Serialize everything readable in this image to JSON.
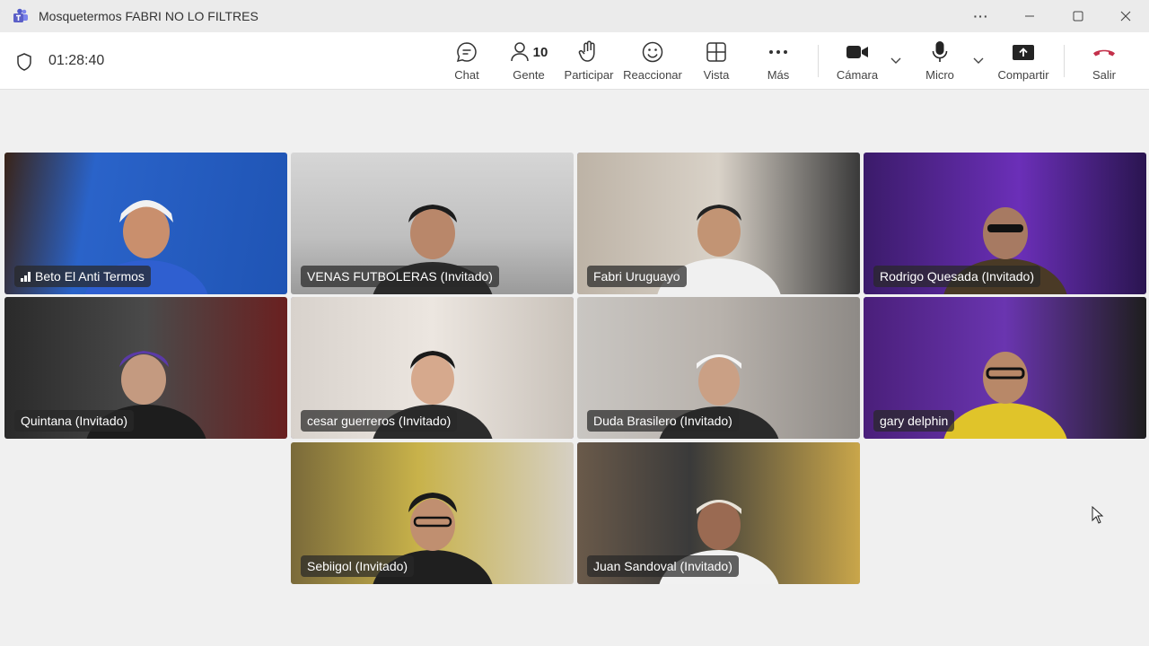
{
  "window": {
    "title": "Mosquetermos FABRI NO LO FILTRES"
  },
  "meeting": {
    "timer": "01:28:40"
  },
  "toolbar": {
    "chat": "Chat",
    "people_count": "10",
    "people": "Gente",
    "participate": "Participar",
    "react": "Reaccionar",
    "view": "Vista",
    "more": "Más",
    "camera": "Cámara",
    "mic": "Micro",
    "share": "Compartir",
    "leave": "Salir"
  },
  "participants": [
    {
      "name": "Beto El Anti Termos"
    },
    {
      "name": "VENAS FUTBOLERAS (Invitado)"
    },
    {
      "name": "Fabri Uruguayo"
    },
    {
      "name": "Rodrigo Quesada (Invitado)"
    },
    {
      "name": "Quintana (Invitado)"
    },
    {
      "name": "cesar guerreros (Invitado)"
    },
    {
      "name": "Duda Brasilero (Invitado)"
    },
    {
      "name": "gary delphin"
    },
    {
      "name": "Sebiigol (Invitado)"
    },
    {
      "name": "Juan Sandoval (Invitado)"
    }
  ],
  "colors": {
    "accent": "#7a73d1",
    "leave": "#c4314b",
    "brand": "#5b5fc7"
  },
  "icons": [
    "teams-logo-icon",
    "shield-icon",
    "chat-icon",
    "people-icon",
    "raise-hand-icon",
    "react-icon",
    "view-icon",
    "more-icon",
    "camera-icon",
    "chevron-down-icon",
    "mic-icon",
    "share-icon",
    "hang-up-icon",
    "signal-icon",
    "cursor-icon"
  ]
}
